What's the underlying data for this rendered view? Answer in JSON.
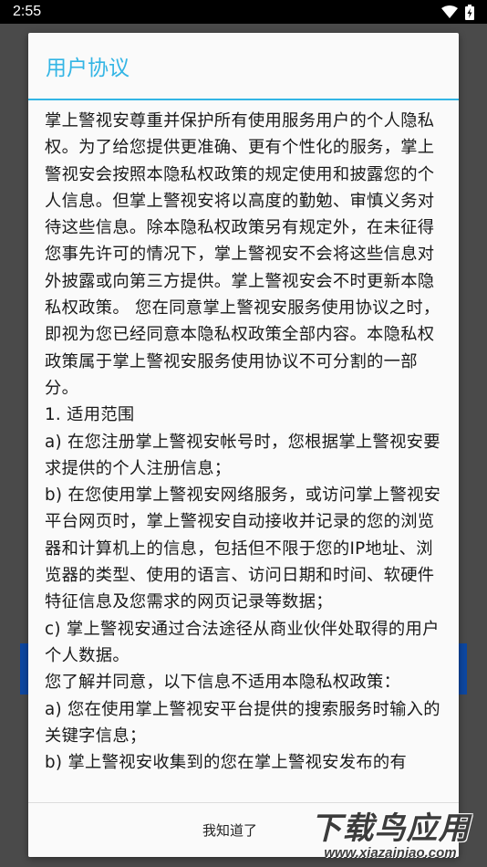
{
  "status_bar": {
    "time": "2:55",
    "icons": [
      "wifi-icon",
      "battery-charging-icon"
    ]
  },
  "dialog": {
    "title": "用户协议",
    "accent_color": "#33b5e5",
    "paragraphs": [
      "掌上警视安尊重并保护所有使用服务用户的个人隐私权。为了给您提供更准确、更有个性化的服务，掌上警视安会按照本隐私权政策的规定使用和披露您的个人信息。但掌上警视安将以高度的勤勉、审慎义务对待这些信息。除本隐私权政策另有规定外，在未征得您事先许可的情况下，掌上警视安不会将这些信息对外披露或向第三方提供。掌上警视安会不时更新本隐私权政策。 您在同意掌上警视安服务使用协议之时，即视为您已经同意本隐私权政策全部内容。本隐私权政策属于掌上警视安服务使用协议不可分割的一部分。",
      "1. 适用范围",
      "a) 在您注册掌上警视安帐号时，您根据掌上警视安要求提供的个人注册信息；",
      "b) 在您使用掌上警视安网络服务，或访问掌上警视安平台网页时，掌上警视安自动接收并记录的您的浏览器和计算机上的信息，包括但不限于您的IP地址、浏览器的类型、使用的语言、访问日期和时间、软硬件特征信息及您需求的网页记录等数据；",
      "c) 掌上警视安通过合法途径从商业伙伴处取得的用户个人数据。",
      "您了解并同意，以下信息不适用本隐私权政策：",
      "a) 您在使用掌上警视安平台提供的搜索服务时输入的关键字信息；",
      "b) 掌上警视安收集到的您在掌上警视安发布的有"
    ],
    "ok_button": "我知道了"
  },
  "watermark": {
    "main": "下载鸟应用",
    "url": "www.xiazainiao.com"
  }
}
